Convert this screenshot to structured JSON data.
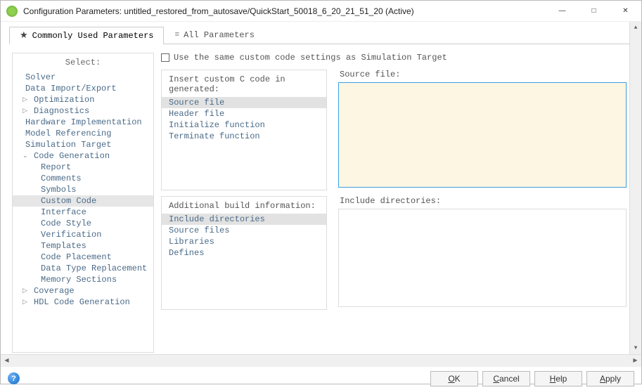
{
  "window": {
    "title": "Configuration Parameters: untitled_restored_from_autosave/QuickStart_50018_6_20_21_51_20 (Active)"
  },
  "tabs": {
    "commonly": "Commonly Used Parameters",
    "all": "All Parameters"
  },
  "sidebar": {
    "heading": "Select:",
    "items": {
      "solver": "Solver",
      "dataio": "Data Import/Export",
      "optimization": "Optimization",
      "diagnostics": "Diagnostics",
      "hardware": "Hardware Implementation",
      "modelref": "Model Referencing",
      "simtarget": "Simulation Target",
      "codegen": "Code Generation",
      "report": "Report",
      "comments": "Comments",
      "symbols": "Symbols",
      "customcode": "Custom Code",
      "interface": "Interface",
      "codestyle": "Code Style",
      "verification": "Verification",
      "templates": "Templates",
      "codeplacement": "Code Placement",
      "datatype": "Data Type Replacement",
      "memsections": "Memory Sections",
      "coverage": "Coverage",
      "hdl": "HDL Code Generation"
    }
  },
  "main": {
    "checkbox_label": "Use the same custom code settings as Simulation Target",
    "insert_group": {
      "title": "Insert custom C code in generated:",
      "items": {
        "source": "Source file",
        "header": "Header file",
        "init": "Initialize function",
        "term": "Terminate function"
      }
    },
    "source_file_label": "Source file:",
    "build_group": {
      "title": "Additional build information:",
      "items": {
        "includedirs": "Include directories",
        "sourcefiles": "Source files",
        "libraries": "Libraries",
        "defines": "Defines"
      }
    },
    "include_dirs_label": "Include directories:"
  },
  "footer": {
    "ok": "OK",
    "ok_ul": "O",
    "ok_rest": "K",
    "cancel": "Cancel",
    "cancel_ul": "C",
    "cancel_rest": "ancel",
    "help": "Help",
    "help_ul": "H",
    "help_rest": "elp",
    "apply": "Apply",
    "apply_ul": "A",
    "apply_rest": "pply"
  }
}
